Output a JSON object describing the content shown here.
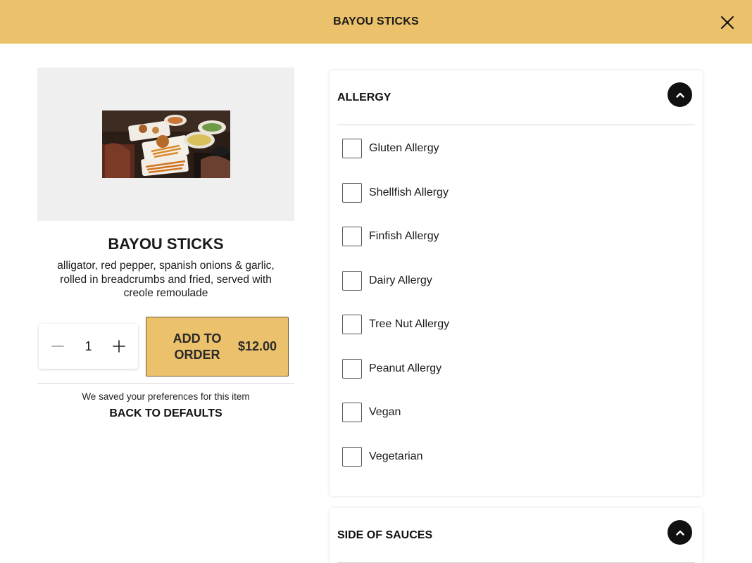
{
  "header": {
    "title": "BAYOU STICKS"
  },
  "item": {
    "title": "BAYOU STICKS",
    "description": "alligator, red pepper, spanish onions & garlic, rolled in breadcrumbs and fried, served with creole remoulade"
  },
  "order": {
    "quantity": "1",
    "add_label": "ADD TO ORDER",
    "price": "$12.00"
  },
  "preferences": {
    "saved_text": "We saved your preferences for this item",
    "defaults_label": "BACK TO DEFAULTS"
  },
  "sections": {
    "allergy": {
      "title": "ALLERGY",
      "options": [
        "Gluten Allergy",
        "Shellfish Allergy",
        "Finfish Allergy",
        "Dairy Allergy",
        "Tree Nut Allergy",
        "Peanut Allergy",
        "Vegan",
        "Vegetarian"
      ]
    },
    "sauces": {
      "title": "SIDE OF SAUCES"
    }
  },
  "icons": {
    "close": "close-icon",
    "minus": "minus-icon",
    "plus": "plus-icon",
    "collapse": "chevron-up-icon"
  },
  "colors": {
    "accent": "#ECC16C",
    "hero_background": "#EFEFEF",
    "dark": "#111111"
  }
}
